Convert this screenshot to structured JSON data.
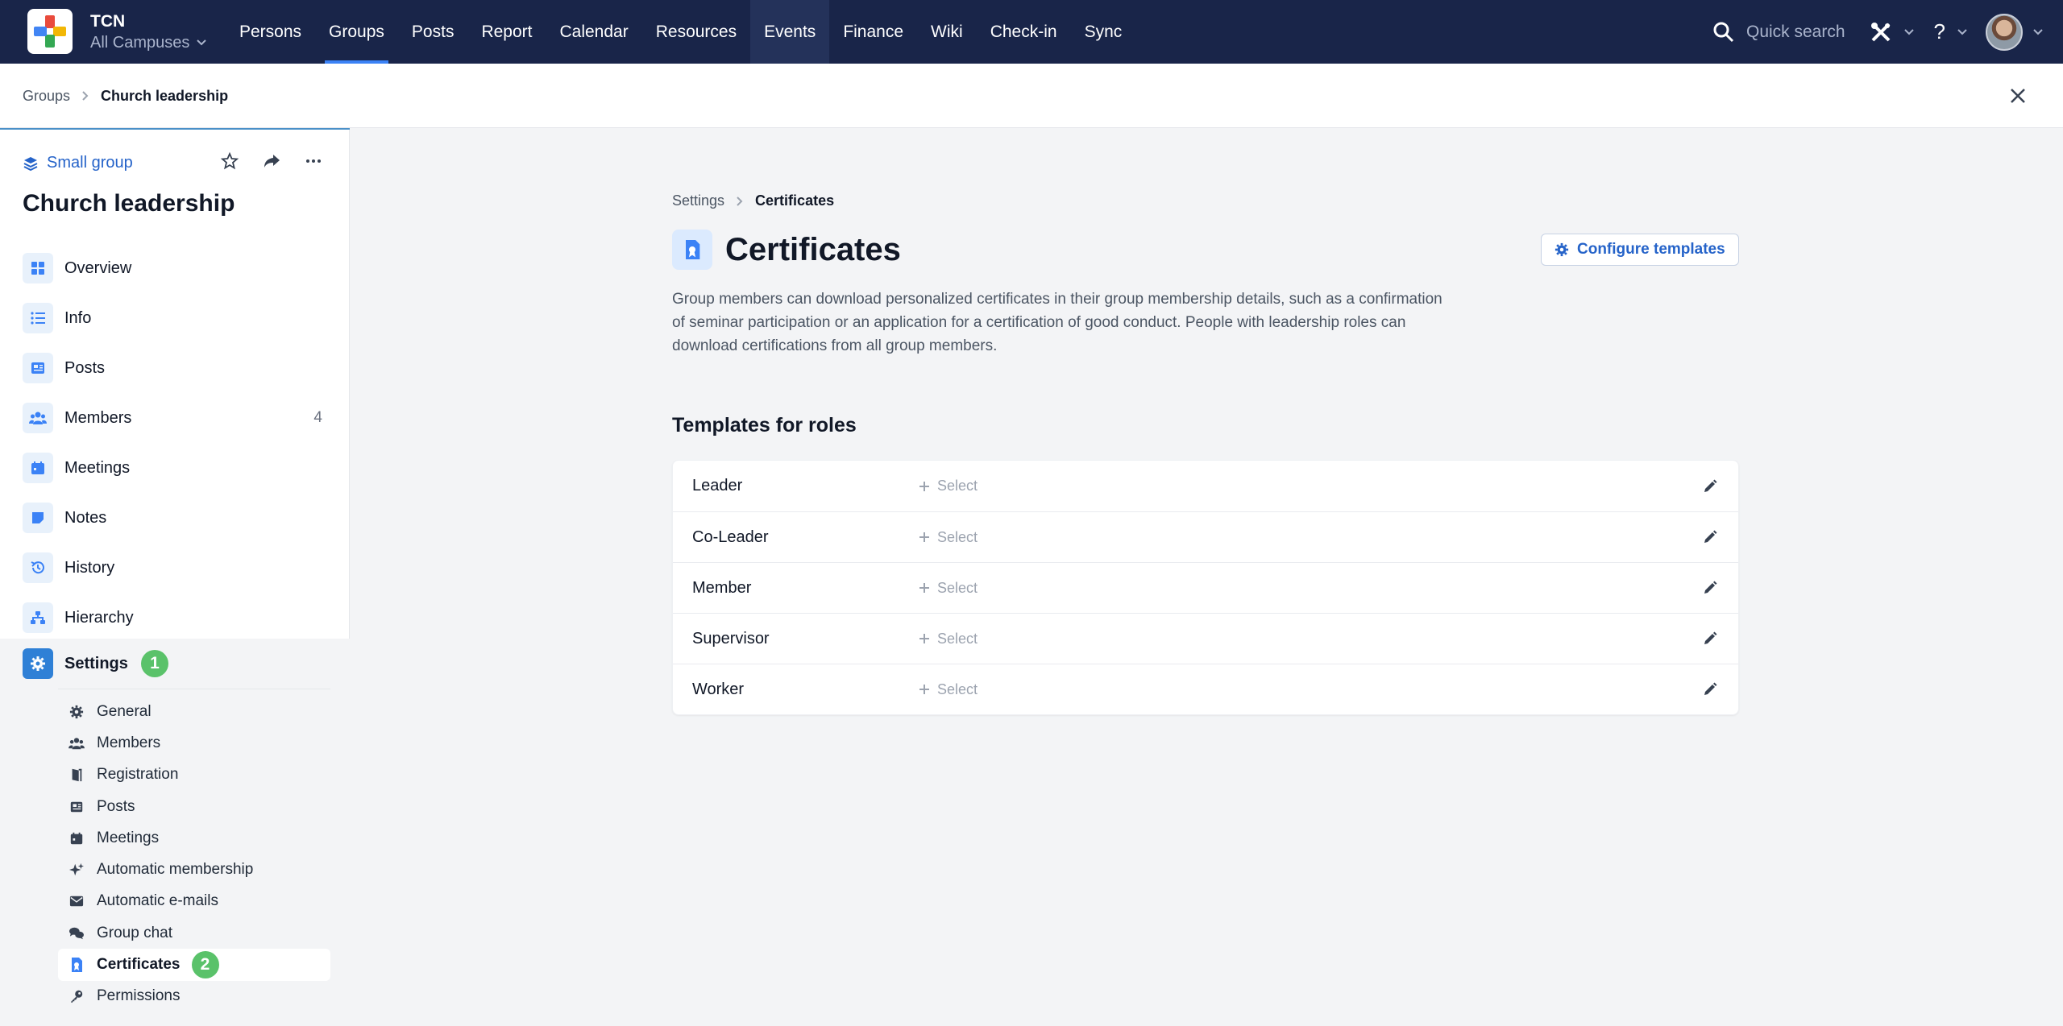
{
  "app": {
    "name": "TCN",
    "campus": "All Campuses"
  },
  "nav": {
    "items": [
      "Persons",
      "Groups",
      "Posts",
      "Report",
      "Calendar",
      "Resources",
      "Events",
      "Finance",
      "Wiki",
      "Check-in",
      "Sync"
    ],
    "active": "Groups",
    "quick_search": "Quick search",
    "help": "?"
  },
  "breadcrumb": {
    "parent": "Groups",
    "current": "Church leadership"
  },
  "sidebar": {
    "group_type": "Small group",
    "group_title": "Church leadership",
    "items": [
      {
        "label": "Overview",
        "icon": "grid-icon"
      },
      {
        "label": "Info",
        "icon": "list-icon"
      },
      {
        "label": "Posts",
        "icon": "newspaper-icon"
      },
      {
        "label": "Members",
        "icon": "users-icon",
        "count": "4"
      },
      {
        "label": "Meetings",
        "icon": "calendar-icon"
      },
      {
        "label": "Notes",
        "icon": "note-icon"
      },
      {
        "label": "History",
        "icon": "history-icon"
      },
      {
        "label": "Hierarchy",
        "icon": "hierarchy-icon"
      }
    ],
    "settings": {
      "label": "Settings",
      "badge": "1",
      "sub_items": [
        {
          "label": "General",
          "icon": "gear-icon"
        },
        {
          "label": "Members",
          "icon": "users-icon"
        },
        {
          "label": "Registration",
          "icon": "door-icon"
        },
        {
          "label": "Posts",
          "icon": "newspaper-icon"
        },
        {
          "label": "Meetings",
          "icon": "calendar-icon"
        },
        {
          "label": "Automatic membership",
          "icon": "sparkles-icon"
        },
        {
          "label": "Automatic e-mails",
          "icon": "envelope-icon"
        },
        {
          "label": "Group chat",
          "icon": "chat-icon"
        },
        {
          "label": "Certificates",
          "icon": "certificate-icon",
          "active": true,
          "badge": "2"
        },
        {
          "label": "Permissions",
          "icon": "key-icon"
        }
      ]
    }
  },
  "main": {
    "breadcrumb": {
      "parent": "Settings",
      "current": "Certificates"
    },
    "title": "Certificates",
    "configure_button": "Configure templates",
    "description": "Group members can download personalized certificates in their group membership details, such as a confirmation of seminar participation or an application for a certification of good conduct. People with leadership roles can download certifications from all group members.",
    "section_title": "Templates for roles",
    "select_label": "Select",
    "roles": [
      "Leader",
      "Co-Leader",
      "Member",
      "Supervisor",
      "Worker"
    ]
  },
  "colors": {
    "nav_bg": "#192549",
    "accent": "#2563c9",
    "badge": "#5ac26a"
  }
}
